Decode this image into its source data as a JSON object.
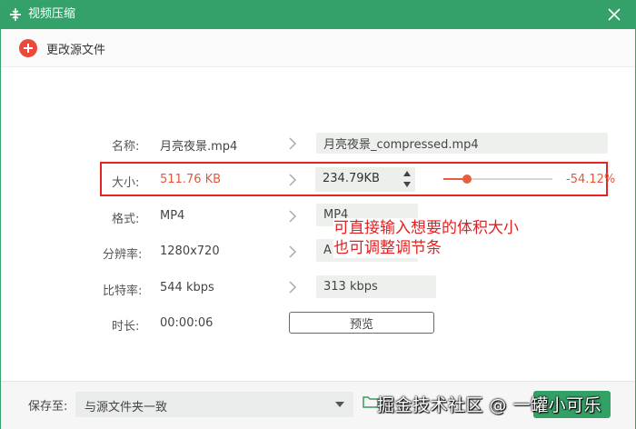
{
  "window": {
    "title": "视频压缩",
    "app_icon": "compress-icon",
    "close_icon": "close-icon",
    "accent_color": "#34a06a"
  },
  "toolbar": {
    "change_source_label": "更改源文件",
    "icon": "plus-circle-icon"
  },
  "rows": {
    "name": {
      "label": "名称:",
      "source": "月亮夜景.mp4",
      "output": "月亮夜景_compressed.mp4"
    },
    "size": {
      "label": "大小:",
      "source": "511.76 KB",
      "output": "234.79KB",
      "percent_text": "-54.12%",
      "slider_fraction": 0.22
    },
    "format": {
      "label": "格式:",
      "source": "MP4",
      "output": "MP4"
    },
    "resolution": {
      "label": "分辨率:",
      "source": "1280x720",
      "output": "A"
    },
    "bitrate": {
      "label": "比特率:",
      "source": "544 kbps",
      "output": "313 kbps"
    },
    "duration": {
      "label": "时长:",
      "source": "00:00:06"
    }
  },
  "preview_button": "预览",
  "annotation": {
    "line1": "可直接输入想要的体积大小",
    "line2": "也可调整调节条",
    "color": "#e41f1f"
  },
  "bottom": {
    "save_to_label": "保存至:",
    "save_option": "与源文件夹一致",
    "folder_icon": "folder-icon"
  },
  "watermark": "掘金技术社区 @ 一罐小可乐"
}
